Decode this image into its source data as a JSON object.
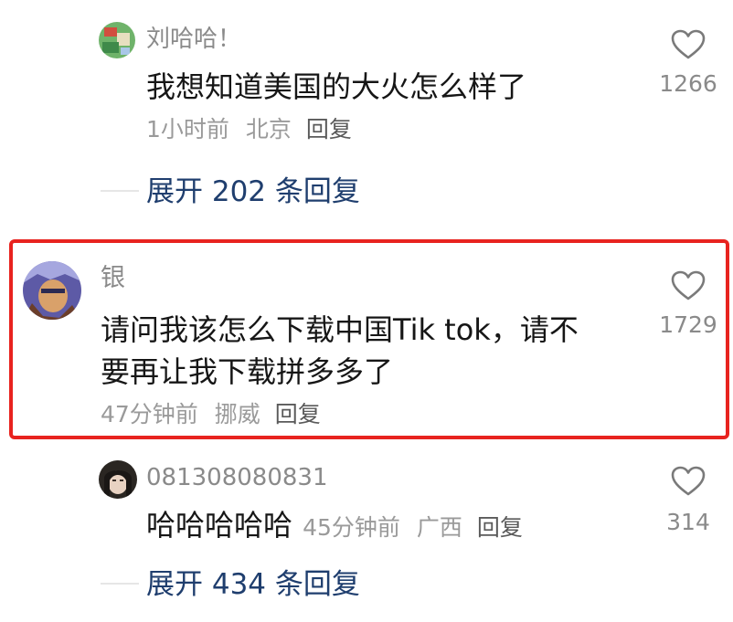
{
  "comments": [
    {
      "username": "刘哈哈！",
      "text": "我想知道美国的大火怎么样了",
      "time": "1小时前",
      "location": "北京",
      "reply_label": "回复",
      "likes": "1266",
      "expand_label": "展开 202 条回复"
    },
    {
      "username": "银",
      "text_line1": "请问我该怎么下载中国Tik tok，请不",
      "text_line2": "要再让我下载拼多多了",
      "time": "47分钟前",
      "location": "挪威",
      "reply_label": "回复",
      "likes": "1729",
      "highlighted": true,
      "highlight_color": "#e8231f"
    },
    {
      "username": "081308080831",
      "text": "哈哈哈哈哈",
      "time": "45分钟前",
      "location": "广西",
      "reply_label": "回复",
      "likes": "314",
      "expand_label": "展开 434 条回复"
    }
  ],
  "icons": {
    "like": "heart-outline-icon"
  },
  "colors": {
    "expand_text": "#1f3e6e",
    "username": "#8a8a8a",
    "meta": "#9a9a9a"
  }
}
